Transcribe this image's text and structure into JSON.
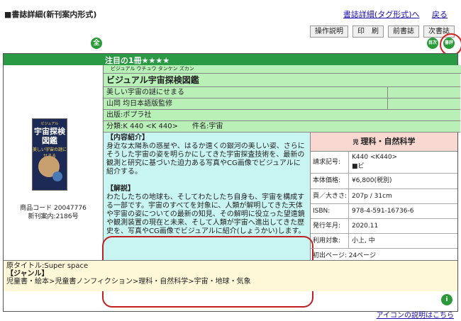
{
  "header": {
    "title": "■書誌詳細(新刊案内形式)",
    "link_tag_format": "書誌詳細(タグ形式)へ",
    "link_back": "戻る"
  },
  "toolbar": {
    "btn_help": "操作説明",
    "btn_print": "印　刷",
    "btn_prev": "前書誌",
    "btn_next": "次書誌"
  },
  "icons": {
    "top_left": "全",
    "mid1": "目次",
    "mid2": "書評"
  },
  "featured": {
    "label": "注目の1冊★★★★"
  },
  "book": {
    "kana": "ビジュアル ウチュウ タンケン ズカン",
    "title": "ビジュアル宇宙探検図鑑",
    "subtitle": "美しい宇宙の謎にせまる",
    "author": "山岡 均日本語版監修",
    "publisher": "出版:ポプラ社",
    "classification": "分類:K 440 <K 440>　　件名:宇宙",
    "cover_line1": "ビジュアル",
    "cover_line2": "宇宙探検",
    "cover_line3": "図鑑",
    "cover_line4": "美しい宇宙の謎にせまる",
    "product_code": "商品コード 20047776",
    "new_issue": "新刊案内:2186号"
  },
  "description": {
    "heading1": "【内容紹介】",
    "text1": "身近な太陽系の惑星や、はるか遠くの銀河の美しい姿、さらにそうした宇宙の姿を明らかにしてきた宇宙探査技術を、最新の観測と研究に基づいた迫力ある写真やCG画像でビジュアルに紹介する。",
    "heading2": "【解説】",
    "text2": "わたしたちの地球も、そしてわたしたち自身も、宇宙を構成する一部です。宇宙のすべてを対象に、人類が解明してきた天体や宇宙の姿についての最新の知見、その解明に役立った望遠鏡や観測装置の現在と未来、そして人類が宇宙へ進出してきた歴史を、写真やCG画像でビジュアルに紹介(しょうかい)します。"
  },
  "details": {
    "subject": "理科・自然科学",
    "subject_prefix": "児",
    "call_no_label": "請求記号:",
    "call_no_value": "K440 <K440>",
    "call_no_extra": "■ビ",
    "price_label": "本体価格:",
    "price_value": "¥6,800(税別)",
    "pages_label": "頁／大きさ:",
    "pages_value": "207p / 31cm",
    "isbn_label": "ISBN:",
    "isbn_value": "978-4-591-16736-6",
    "year_label": "発行年月:",
    "year_value": "2020.11",
    "target_label": "利用対象:",
    "target_value": "小上, 中",
    "first_page": "初出ページ: 24ページ"
  },
  "footer": {
    "original_title": "原タイトル:Super space",
    "genre_heading": "【ジャンル】",
    "genre_path": "児童書・絵本>児童書ノンフィクション>理科・自然科学>宇宙・地球・気象",
    "icon_help_link": "アイコンの説明はこちら"
  },
  "colors": {
    "green_bar": "#2b9a45",
    "info_bg": "#b8f0b8",
    "desc_bg": "#c8f4f2",
    "subject_bg": "#f8d8d0",
    "footer_bg": "#fff8d8",
    "highlight_red": "#c02020"
  }
}
